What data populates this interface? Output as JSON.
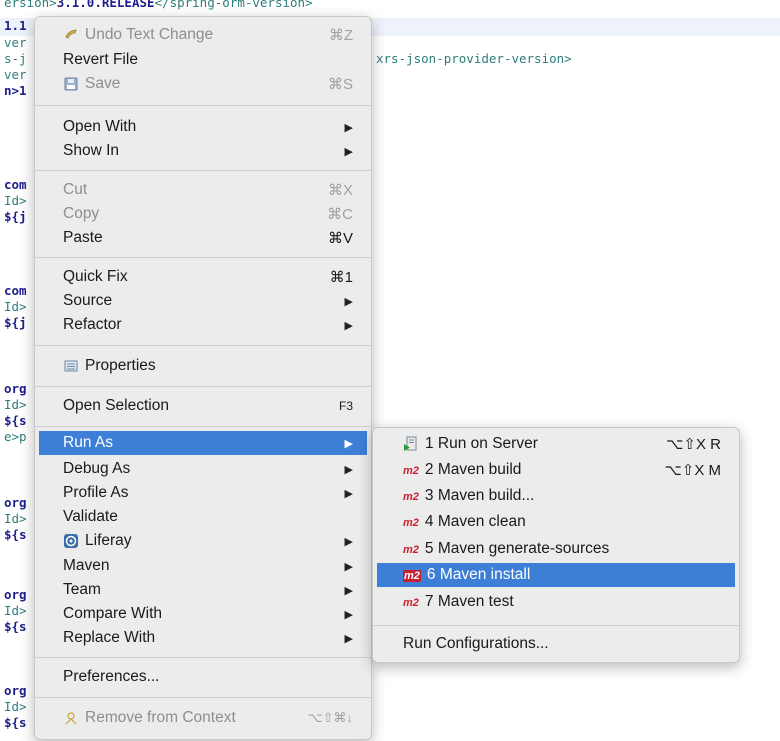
{
  "editor": {
    "lines": [
      {
        "pre": "ersion>",
        "mid": "3.1.0.RELEASE",
        "post": "</spring-orm-version>"
      },
      {
        "pre": "1.1",
        "mid": "",
        "post": ""
      },
      {
        "pre": "ver",
        "mid": "",
        "post": ""
      },
      {
        "pre": "s-j",
        "mid": "",
        "post": "xrs-json-provider-version>"
      },
      {
        "pre": "ver",
        "mid": "",
        "post": ""
      },
      {
        "pre": "n>1",
        "mid": "",
        "post": ""
      },
      {
        "pre": "com",
        "mid": "",
        "post": ""
      },
      {
        "pre": "Id>",
        "mid": "",
        "post": ""
      },
      {
        "pre": "${j",
        "mid": "",
        "post": ""
      },
      {
        "pre": "com",
        "mid": "",
        "post": ""
      },
      {
        "pre": "Id>",
        "mid": "",
        "post": ""
      },
      {
        "pre": "${j",
        "mid": "",
        "post": ""
      },
      {
        "pre": "org",
        "mid": "",
        "post": ""
      },
      {
        "pre": "Id>",
        "mid": "",
        "post": ""
      },
      {
        "pre": "${s",
        "mid": "",
        "post": ""
      },
      {
        "pre": "e>p",
        "mid": "",
        "post": ""
      },
      {
        "pre": "org",
        "mid": "",
        "post": ""
      },
      {
        "pre": "Id>",
        "mid": "",
        "post": ""
      },
      {
        "pre": "${s",
        "mid": "",
        "post": ""
      },
      {
        "pre": "org",
        "mid": "",
        "post": ""
      },
      {
        "pre": "Id>",
        "mid": "",
        "post": ""
      },
      {
        "pre": "${s",
        "mid": "",
        "post": ""
      },
      {
        "pre": "org",
        "mid": "",
        "post": ""
      },
      {
        "pre": "Id>",
        "mid": "",
        "post": ""
      },
      {
        "pre": "${s",
        "mid": "",
        "post": ""
      }
    ]
  },
  "main_menu": {
    "undo": {
      "label": "Undo Text Change",
      "shortcut": "⌘Z",
      "icon": "undo-icon"
    },
    "revert": {
      "label": "Revert File"
    },
    "save": {
      "label": "Save",
      "shortcut": "⌘S",
      "icon": "save-icon"
    },
    "open_with": {
      "label": "Open With"
    },
    "show_in": {
      "label": "Show In"
    },
    "cut": {
      "label": "Cut",
      "shortcut": "⌘X"
    },
    "copy": {
      "label": "Copy",
      "shortcut": "⌘C"
    },
    "paste": {
      "label": "Paste",
      "shortcut": "⌘V"
    },
    "quick_fix": {
      "label": "Quick Fix",
      "shortcut": "⌘1"
    },
    "source": {
      "label": "Source"
    },
    "refactor": {
      "label": "Refactor"
    },
    "properties": {
      "label": "Properties",
      "icon": "properties-icon"
    },
    "open_selection": {
      "label": "Open Selection",
      "shortcut": "F3"
    },
    "run_as": {
      "label": "Run As"
    },
    "debug_as": {
      "label": "Debug As"
    },
    "profile_as": {
      "label": "Profile As"
    },
    "validate": {
      "label": "Validate"
    },
    "liferay": {
      "label": "Liferay",
      "icon": "liferay-icon"
    },
    "maven": {
      "label": "Maven"
    },
    "team": {
      "label": "Team"
    },
    "compare_with": {
      "label": "Compare With"
    },
    "replace_with": {
      "label": "Replace With"
    },
    "preferences": {
      "label": "Preferences..."
    },
    "remove_context": {
      "label": "Remove from Context",
      "shortcut": "⌥⇧⌘↓",
      "icon": "context-icon"
    }
  },
  "sub_menu": {
    "m2_badge": "m2",
    "items": [
      {
        "label": "1 Run on Server",
        "shortcut": "⌥⇧X R",
        "icon": "server-icon"
      },
      {
        "label": "2 Maven build",
        "shortcut": "⌥⇧X M",
        "icon": "maven-icon"
      },
      {
        "label": "3 Maven build...",
        "shortcut": "",
        "icon": "maven-icon"
      },
      {
        "label": "4 Maven clean",
        "shortcut": "",
        "icon": "maven-icon"
      },
      {
        "label": "5 Maven generate-sources",
        "shortcut": "",
        "icon": "maven-icon"
      },
      {
        "label": "6 Maven install",
        "shortcut": "",
        "icon": "maven-icon"
      },
      {
        "label": "7 Maven test",
        "shortcut": "",
        "icon": "maven-icon"
      }
    ],
    "run_configurations": {
      "label": "Run Configurations..."
    }
  },
  "colors": {
    "selection": "#3d7fd6",
    "menu_bg": "#ececec",
    "maven_red": "#c8202d"
  }
}
